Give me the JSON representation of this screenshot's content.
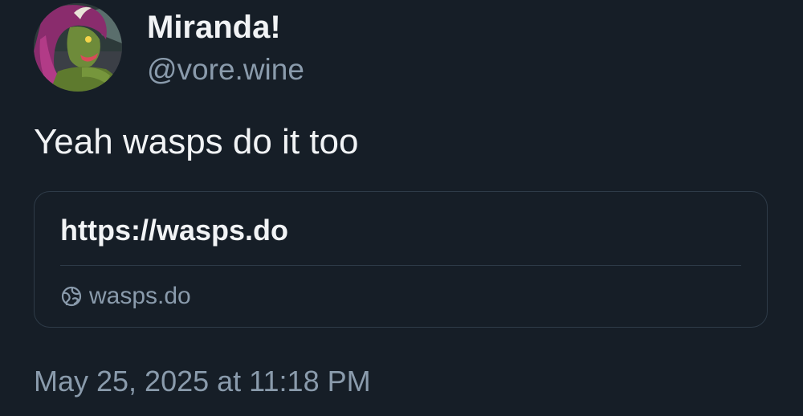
{
  "post": {
    "author": {
      "display_name": "Miranda!",
      "handle": "@vore.wine",
      "avatar_icon": "avatar-image"
    },
    "text": "Yeah wasps do it too",
    "link_card": {
      "title": "https://wasps.do",
      "domain": "wasps.do",
      "domain_icon": "globe-icon"
    },
    "timestamp": "May 25, 2025 at 11:18 PM"
  },
  "colors": {
    "background": "#161e27",
    "primary_text": "#f1f3f5",
    "secondary_text": "#8a9bac",
    "border": "#2e3b48"
  }
}
